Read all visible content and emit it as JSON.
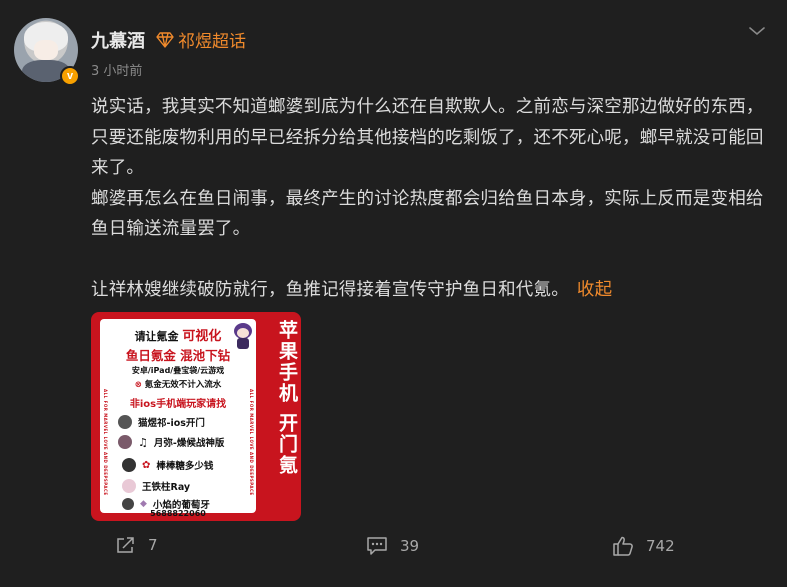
{
  "post": {
    "author": "九慕酒",
    "topic": "祁煜超话",
    "time": "3 小时前",
    "paragraphs": [
      "说实话，我其实不知道螂婆到底为什么还在自欺欺人。之前恋与深空那边做好的东西，只要还能废物利用的早已经拆分给其他接档的吃剩饭了，还不死心呢，螂早就没可能回来了。",
      "螂婆再怎么在鱼日闹事，最终产生的讨论热度都会归给鱼日本身，实际上反而是变相给鱼日输送流量罢了。"
    ],
    "last_paragraph": "让祥林嫂继续破防就行，鱼推记得接着宣传守护鱼日和代氪。",
    "collapse_label": "收起"
  },
  "promo": {
    "line1_a": "请让氪金",
    "line1_b": "可视化",
    "line2": "鱼日氪金 混池下钻",
    "line3": "安卓/iPad/叠宝袋/云游戏",
    "line4": "氪金无效不计入流水",
    "line5": "非ios手机端玩家请找",
    "rows": [
      "猫煜祁-ios开门",
      "月弥-燥候战神版",
      "棒棒糖多少钱",
      "王铁柱Ray",
      "小焰的葡萄牙"
    ],
    "phone": "5688822060",
    "side_text": "苹果手机 开门氪",
    "vertical_small": "ALL FOR MARVEL LOVE AND DEEPSPACE"
  },
  "actions": {
    "share_count": "7",
    "comment_count": "39",
    "like_count": "742"
  },
  "colors": {
    "background": "#1f1f1f",
    "accent": "#f08a2c",
    "promo_red": "#c8141e",
    "verify": "#f7a000"
  }
}
